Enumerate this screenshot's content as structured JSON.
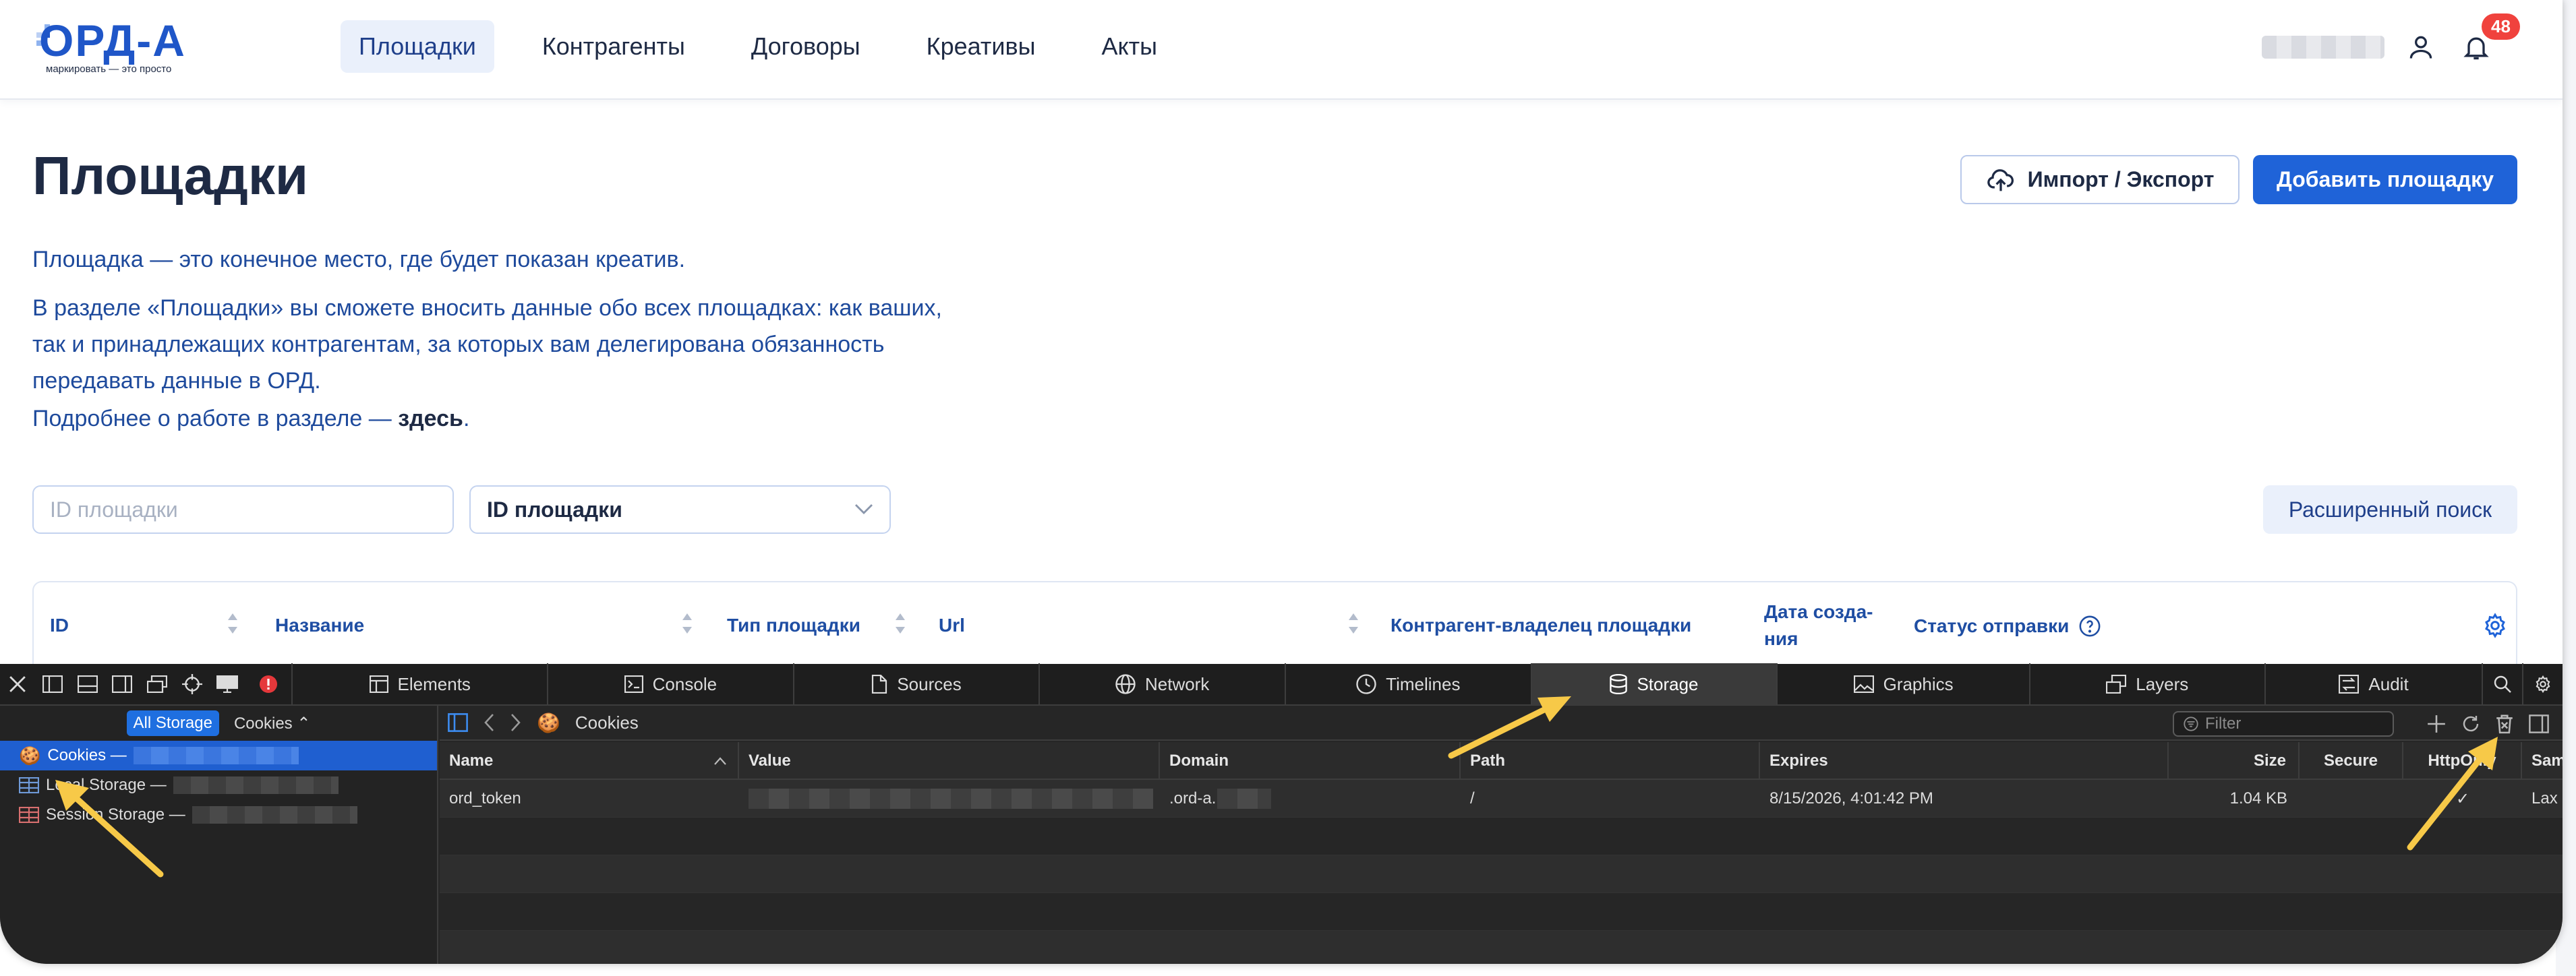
{
  "header": {
    "logo_word": "ОРД-А",
    "logo_tagline": "маркировать — это просто",
    "nav": [
      "Площадки",
      "Контрагенты",
      "Договоры",
      "Креативы",
      "Акты"
    ],
    "active_nav": "Площадки",
    "notifications_count": "48",
    "icons": [
      "user-icon",
      "bell-icon"
    ]
  },
  "page": {
    "title": "Площадки",
    "import_label": "Импорт / Экспорт",
    "add_label": "Добавить площадку",
    "desc_1": "Площадка — это конечное место, где будет показан креатив.",
    "desc_2": "В разделе «Площадки» вы сможете вносить данные обо всех площадках: как ваших, так и принадлежащих контрагентам, за которых вам делегирована обязанность передавать данные в ОРД.",
    "desc_more_prefix": "Подробнее о работе в разделе — ",
    "desc_more_link": "здесь",
    "desc_more_suffix": ".",
    "search_placeholder": "ID площадки",
    "select_value": "ID площадки",
    "advanced_search_label": "Расширенный поиск",
    "table_headers": {
      "id": "ID",
      "name": "Название",
      "type": "Тип площадки",
      "url": "Url",
      "owner": "Контрагент-владелец площадки",
      "created": "Дата созда-\nния",
      "status": "Статус отправки"
    }
  },
  "devtools": {
    "tabs": [
      "Elements",
      "Console",
      "Sources",
      "Network",
      "Timelines",
      "Storage",
      "Graphics",
      "Layers",
      "Audit"
    ],
    "active_tab": "Storage",
    "left": {
      "all_storage": "All Storage",
      "type_select": "Cookies ⌃",
      "items": [
        {
          "label": "Cookies —",
          "selected": true
        },
        {
          "label": "Local Storage —",
          "selected": false
        },
        {
          "label": "Session Storage —",
          "selected": false
        }
      ]
    },
    "breadcrumb": "Cookies",
    "filter_placeholder": "Filter",
    "columns": [
      "Name",
      "Value",
      "Domain",
      "Path",
      "Expires",
      "Size",
      "Secure",
      "HttpOnly",
      "SameSite"
    ],
    "rows": [
      {
        "name": "ord_token",
        "domain": ".ord-a.",
        "path": "/",
        "expires": "8/15/2026, 4:01:42 PM",
        "size": "1.04 KB",
        "secure": "",
        "httponly": "✓",
        "samesite": "Lax"
      }
    ]
  },
  "colors": {
    "brand_blue": "#1f63d8",
    "text_dark": "#1e2a44",
    "text_blue": "#1e4a9c",
    "badge_red": "#f0423d",
    "devtools_bg": "#262626",
    "devtools_selected": "#1f5fd0",
    "annotation_arrow": "#f7c948"
  }
}
